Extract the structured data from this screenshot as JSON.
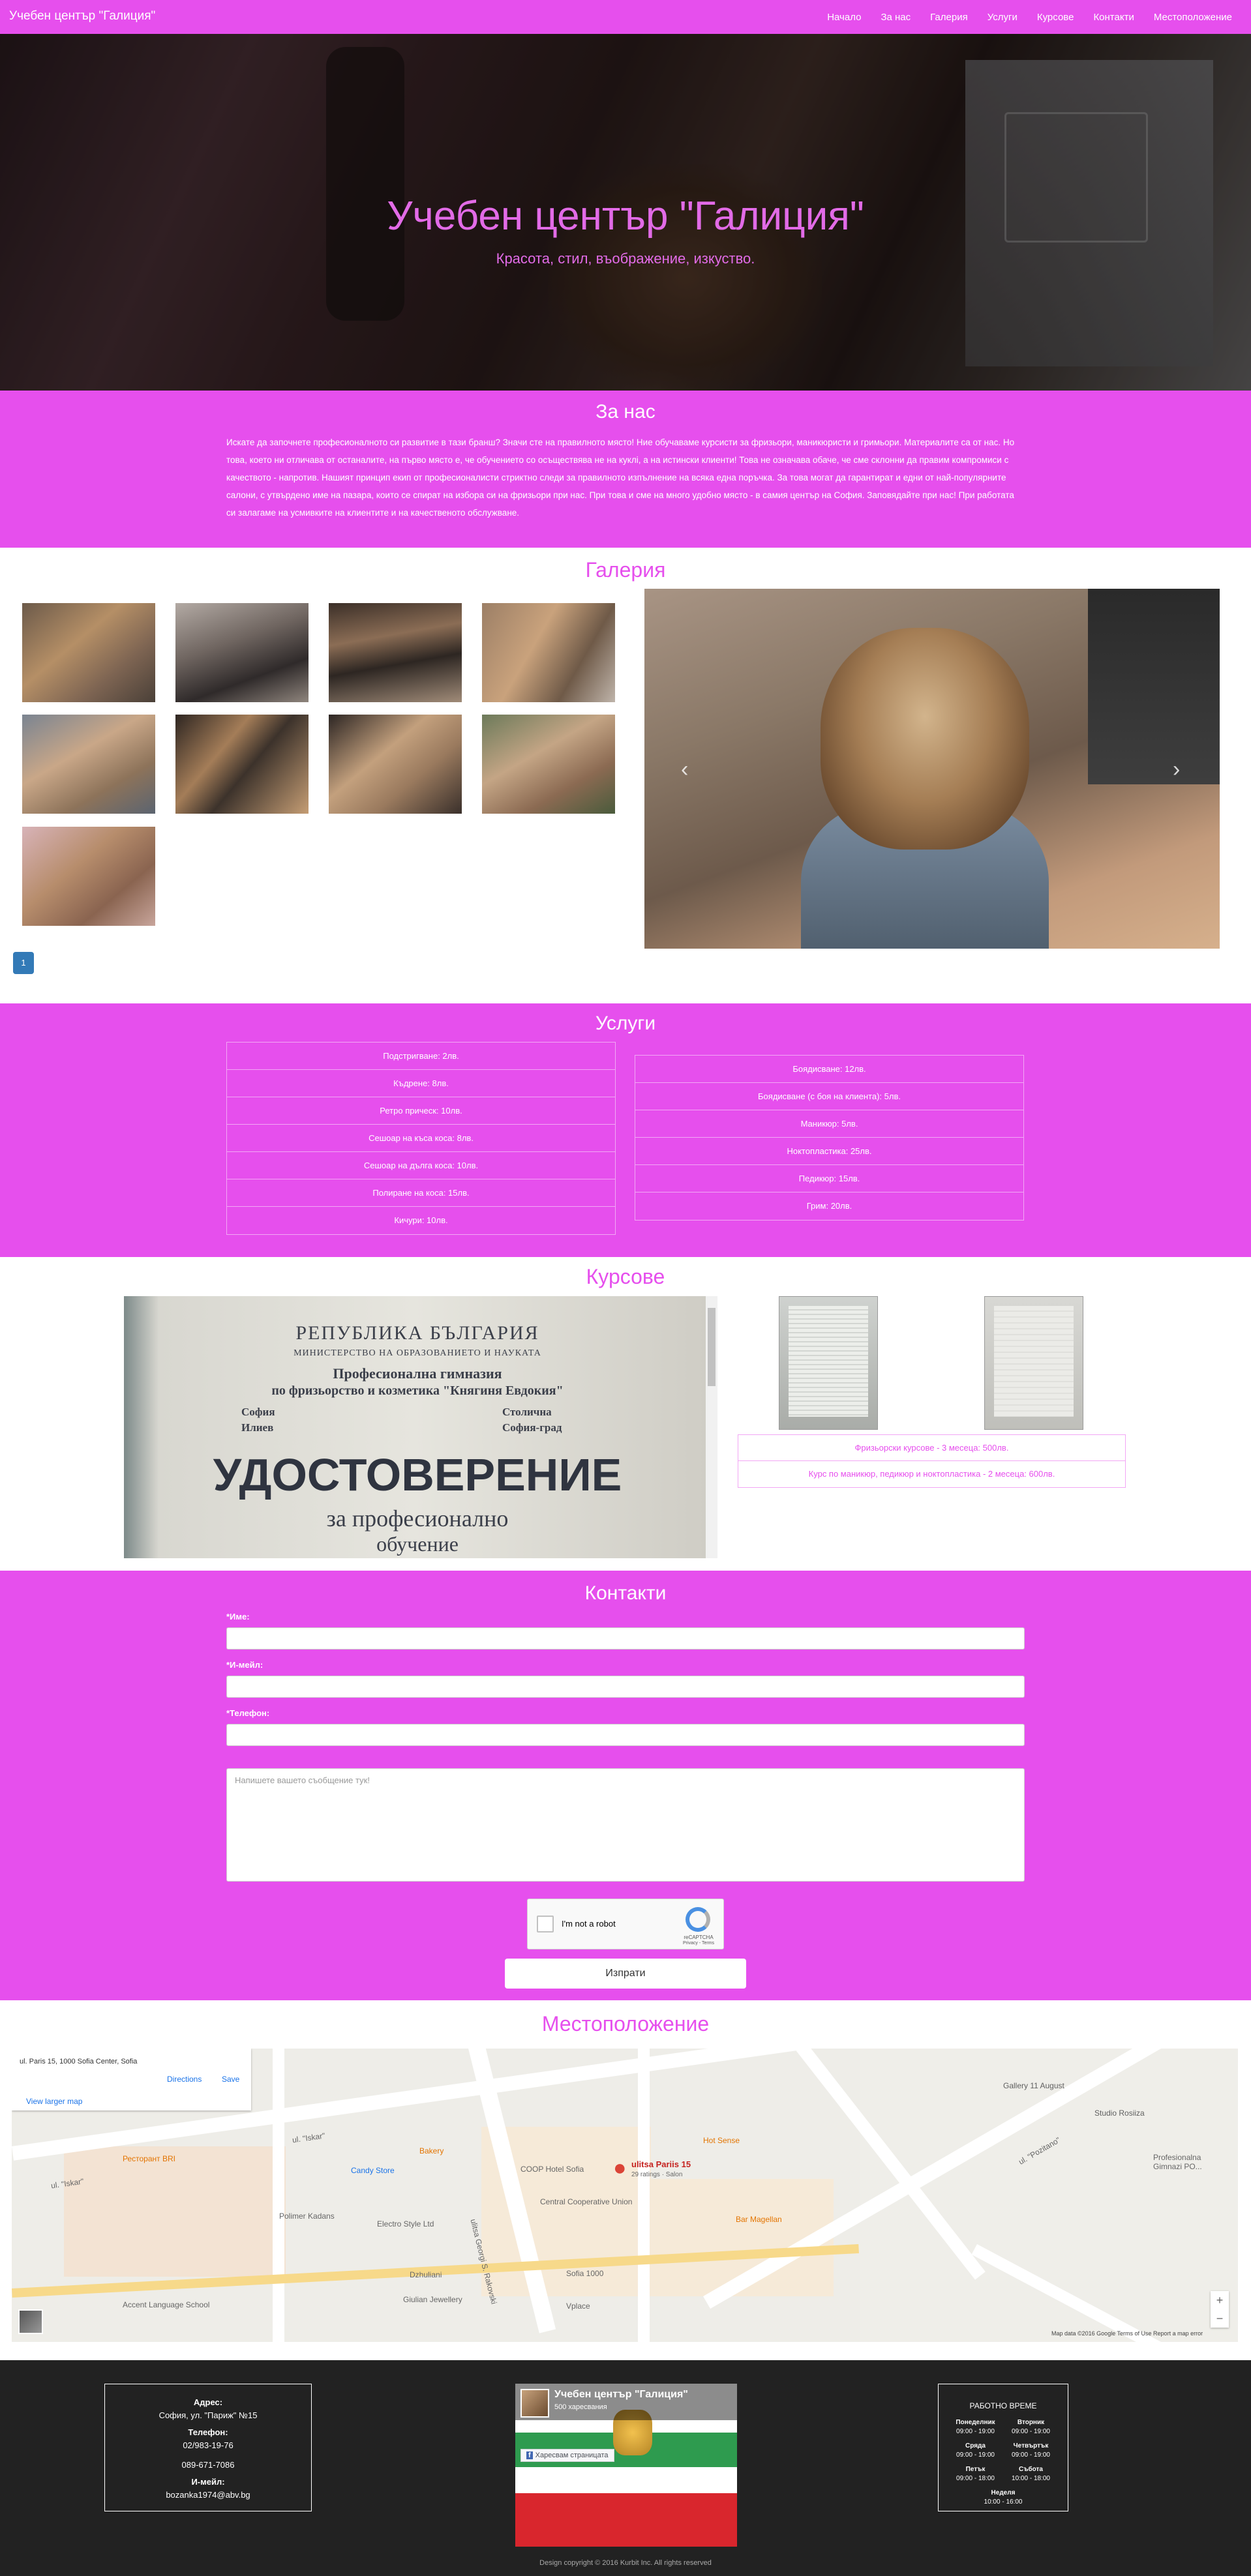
{
  "navbar": {
    "brand": "Учебен център \"Галиция\"",
    "links": [
      "Начало",
      "За нас",
      "Галерия",
      "Услуги",
      "Курсове",
      "Контакти",
      "Местоположение"
    ]
  },
  "hero": {
    "title": "Учебен център \"Галиция\"",
    "subtitle": "Красота, стил, въображение, изкуство."
  },
  "about": {
    "title": "За нас",
    "text": "Искате да започнете професионалното си развитие в тази бранш? Значи сте на правилното място! Ние обучаваме курсисти за фризьори, маникюристи и гримьори. Материалите са от нас. Но това, което ни отличава от останалите, на първо място е, че обучението со осъществява не на куклi, а на истински клиенти! Това не означава обаче, че сме склонни да правим компромиси с качеството - напротив. Нашият принцип екип от професионалисти стриктно следи за правилното изпълнение на всяка една поръчка. За това могат да гарантират и едни от най-популярните салони, с утвърдено име на пазара, които се спират на избора си на фризьори при нас. При това и сме на много удобно място - в самия център на София. Заповядайте при нас! При работата си залагаме на усмивките на клиентите и на качественото обслужване."
  },
  "gallery": {
    "title": "Галерия",
    "page": "1",
    "prev_icon": "‹",
    "next_icon": "›"
  },
  "services": {
    "title": "Услуги",
    "left": [
      "Подстригване: 2лв.",
      "Къдрене: 8лв.",
      "Ретро прическ: 10лв.",
      "Сешоар на къса коса: 8лв.",
      "Сешоар на дълга коса: 10лв.",
      "Полиране на коса: 15лв.",
      "Кичури: 10лв."
    ],
    "right": [
      "Боядисване: 12лв.",
      "Боядисване (с боя на клиента): 5лв.",
      "Маникюр: 5лв.",
      "Ноктопластика: 25лв.",
      "Педикюр: 15лв.",
      "Грим: 20лв."
    ]
  },
  "courses": {
    "title": "Курсове",
    "certificate": {
      "line1": "РЕПУБЛИКА БЪЛГАРИЯ",
      "line2": "МИНИСТЕРСТВО НА ОБРАЗОВАНИЕТО И НАУКАТА",
      "line3": "Професионална гимназия",
      "line4": "по фризьорство и козметика \"Княгиня Евдокия\"",
      "row1_value": "София",
      "row1_value2": "Столична",
      "row2_value": "Илиев",
      "row2_value2": "София-град",
      "heading": "УДОСТОВЕРЕНИЕ",
      "sub1": "за професионално",
      "sub2": "обучение"
    },
    "items": [
      "Фризьорски курсове - 3 месеца: 500лв.",
      "Курс по маникюр, педикюр и ноктопластика - 2 месеца: 600лв."
    ]
  },
  "contact": {
    "title": "Контакти",
    "name_label": "*Име:",
    "email_label": "*И-мейл:",
    "phone_label": "*Телефон:",
    "message_placeholder": "Напишете вашето съобщение тук!",
    "captcha_text": "I'm not a robot",
    "captcha_brand": "reCAPTCHA",
    "captcha_links": "Privacy - Terms",
    "send": "Изпрати"
  },
  "location": {
    "title": "Местоположение",
    "map": {
      "address": "ul. Paris 15, 1000 Sofia Center, Sofia",
      "directions": "Directions",
      "save": "Save",
      "larger_map": "View larger map",
      "pin_label": "ulitsa Pariis 15",
      "pin_sub": "29 ratings · Salon",
      "streets": [
        "ul. \"Iskar\"",
        "ul. \"Iskar\"",
        "ulitsa Georgi S. Rakovski",
        "ul. \"Pozitano\"",
        "Gallery 11 August",
        "Studio Rosiiza",
        "Profesionalna Gimnazi PO..."
      ],
      "places": [
        "Ресторант BRI",
        "Candy Store",
        "Bakery",
        "Polimer Kadans",
        "Electro Style Ltd",
        "Central Cooperative Union",
        "Hot Sense",
        "Bar Magellan",
        "Sofia 1000",
        "Dzhuliani",
        "Giulian Jewellery",
        "Accent Language School",
        "COOP Hotel Sofia",
        "Vplace"
      ],
      "footer": "Map data ©2016 Google   Terms of Use   Report a map error"
    }
  },
  "footer": {
    "address_label": "Адрес:",
    "address": "София, ул. \"Париж\" №15",
    "phone_label": "Телефон:",
    "phone1": "02/983-19-76",
    "phone2": "089-671-7086",
    "email_label": "И-мейл:",
    "email": "bozanka1974@abv.bg",
    "fb_title": "Учебен център \"Галиция\"",
    "fb_likes": "500 харесвания",
    "fb_button": "Харесвам страницата",
    "hours": {
      "title": "РАБОТНО ВРЕМЕ",
      "days": [
        {
          "day": "Понеделник",
          "time": "09:00 - 19:00"
        },
        {
          "day": "Вторник",
          "time": "09:00 - 19:00"
        },
        {
          "day": "Сряда",
          "time": "09:00 - 19:00"
        },
        {
          "day": "Четвъртък",
          "time": "09:00 - 19:00"
        },
        {
          "day": "Петък",
          "time": "09:00 - 18:00"
        },
        {
          "day": "Събота",
          "time": "10:00 - 18:00"
        },
        {
          "day": "Неделя",
          "time": "10:00 - 16:00"
        }
      ]
    },
    "copyright": "Design copyright © 2016 Kurbit Inc. All rights reserved"
  },
  "colors": {
    "accent": "#e64fed",
    "footer_bg": "#222222"
  }
}
